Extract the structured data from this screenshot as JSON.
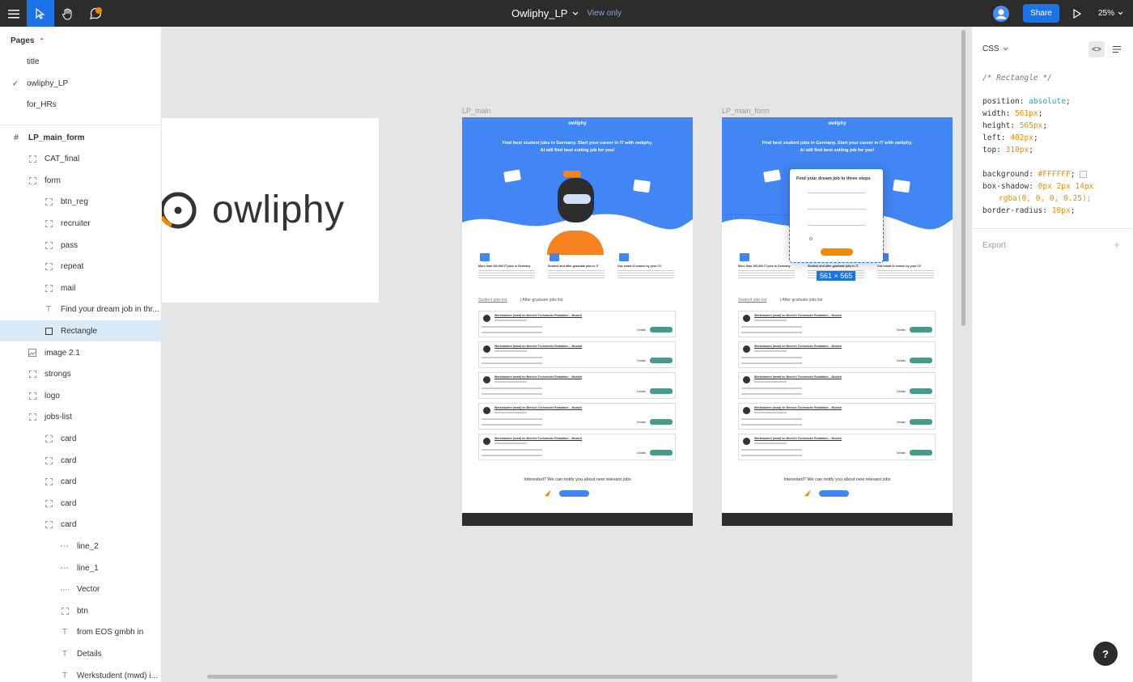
{
  "topbar": {
    "title": "Owliphy_LP",
    "view_only": "View only",
    "share": "Share",
    "zoom": "25%"
  },
  "left": {
    "pages_header": "Pages",
    "pages": [
      "title",
      "owliphy_LP",
      "for_HRs"
    ],
    "layers": [
      {
        "label": "LP_main_form",
        "kind": "frame"
      },
      {
        "label": "CAT_final",
        "kind": "group"
      },
      {
        "label": "form",
        "kind": "group"
      },
      {
        "label": "btn_reg",
        "kind": "group"
      },
      {
        "label": "recruiter",
        "kind": "group"
      },
      {
        "label": "pass",
        "kind": "group"
      },
      {
        "label": "repeat",
        "kind": "group"
      },
      {
        "label": "mail",
        "kind": "group"
      },
      {
        "label": "Find your dream job in thr...",
        "kind": "text"
      },
      {
        "label": "Rectangle",
        "kind": "rect"
      },
      {
        "label": "image 2.1",
        "kind": "image"
      },
      {
        "label": "strongs",
        "kind": "group"
      },
      {
        "label": "logo",
        "kind": "group"
      },
      {
        "label": "jobs-list",
        "kind": "group"
      },
      {
        "label": "card",
        "kind": "group"
      },
      {
        "label": "card",
        "kind": "group"
      },
      {
        "label": "card",
        "kind": "group"
      },
      {
        "label": "card",
        "kind": "group"
      },
      {
        "label": "card",
        "kind": "group"
      },
      {
        "label": "line_2",
        "kind": "line"
      },
      {
        "label": "line_1",
        "kind": "line"
      },
      {
        "label": "Vector",
        "kind": "vector"
      },
      {
        "label": "btn",
        "kind": "group"
      },
      {
        "label": "from EOS gmbh in",
        "kind": "text"
      },
      {
        "label": "Details",
        "kind": "text"
      },
      {
        "label": "Werkstudent (mwd) i...",
        "kind": "text"
      }
    ]
  },
  "canvas": {
    "logo_text": "owliphy",
    "frame1_label": "LP_main",
    "frame2_label": "LP_main_form",
    "hero_headline": "Find best student jobs in Germany. Start your career in IT with owliphy.",
    "hero_sub": "AI will find best suiting job for you!",
    "brand": "owliphy",
    "form_title": "Find your dream job in three steps",
    "size_badge": "561 × 565",
    "features": [
      "More than 100,000 IT jobs in Germany",
      "Student and after-graduate jobs in IT",
      "Use smart AI search by your CV"
    ],
    "tabs": [
      "Student jobs list",
      "After-graduate jobs list"
    ],
    "job_title": "Werkstudent (mwd) im Bereich Technische Redaktion – Munich",
    "details": "Details",
    "notify_text": "Interested? We can notify you about new relevant jobs"
  },
  "right": {
    "tab": "CSS",
    "comment": "/* Rectangle */",
    "props": [
      {
        "k": "position",
        "v": "absolute"
      },
      {
        "k": "width",
        "v": "561px"
      },
      {
        "k": "height",
        "v": "565px"
      },
      {
        "k": "left",
        "v": "402px"
      },
      {
        "k": "top",
        "v": "310px"
      }
    ],
    "background": "#FFFFFF",
    "box_shadow_1": "0px 2px 14px",
    "box_shadow_2": "rgba(0, 0, 0, 0.25);",
    "border_radius": "10px",
    "export": "Export"
  },
  "colors": {
    "accent": "#1a73e8",
    "hero": "#4285f4",
    "orange": "#f08a00",
    "green": "#4a9a8a"
  }
}
